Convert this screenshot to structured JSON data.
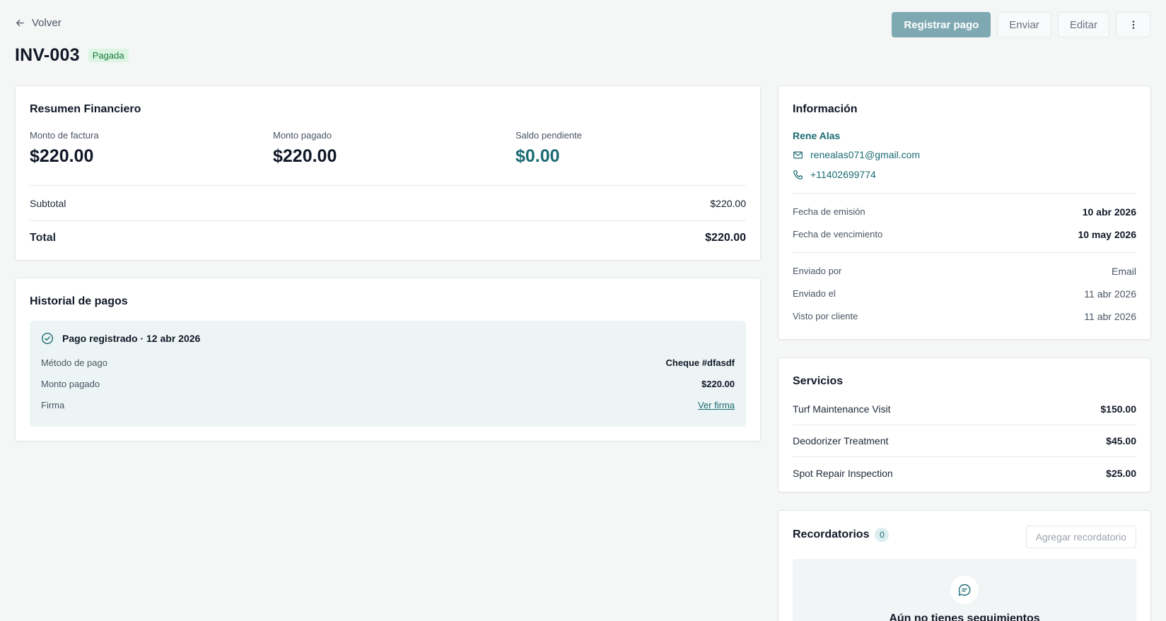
{
  "nav": {
    "back_label": "Volver"
  },
  "actions": {
    "register_payment": "Registrar pago",
    "send": "Enviar",
    "edit": "Editar",
    "more": "⋮"
  },
  "invoice": {
    "number": "INV-003",
    "status": "Pagada"
  },
  "summary": {
    "title": "Resumen Financiero",
    "invoice_amount_label": "Monto de factura",
    "invoice_amount": "$220.00",
    "paid_amount_label": "Monto pagado",
    "paid_amount": "$220.00",
    "balance_label": "Saldo pendiente",
    "balance": "$0.00",
    "subtotal_label": "Subtotal",
    "subtotal": "$220.00",
    "total_label": "Total",
    "total": "$220.00"
  },
  "history": {
    "title": "Historial de pagos",
    "entry": {
      "heading": "Pago registrado · 12 abr 2026",
      "method_label": "Método de pago",
      "method": "Cheque #dfasdf",
      "amount_label": "Monto pagado",
      "amount": "$220.00",
      "signature_label": "Firma",
      "signature_link": "Ver firma"
    }
  },
  "info": {
    "title": "Información",
    "client_name": "Rene Alas",
    "email": "renealas071@gmail.com",
    "phone": "+11402699774",
    "issue_date_label": "Fecha de emisión",
    "issue_date": "10 abr 2026",
    "due_date_label": "Fecha de vencimiento",
    "due_date": "10 may 2026",
    "sent_by_label": "Enviado por",
    "sent_by": "Email",
    "sent_on_label": "Enviado el",
    "sent_on": "11 abr 2026",
    "viewed_label": "Visto por cliente",
    "viewed_on": "11 abr 2026"
  },
  "services": {
    "title": "Servicios",
    "items": [
      {
        "name": "Turf Maintenance Visit",
        "price": "$150.00"
      },
      {
        "name": "Deodorizer Treatment",
        "price": "$45.00"
      },
      {
        "name": "Spot Repair Inspection",
        "price": "$25.00"
      }
    ]
  },
  "reminders": {
    "title": "Recordatorios",
    "count": "0",
    "add_label": "Agregar recordatorio",
    "empty_text": "Aún no tienes seguimientos"
  },
  "colors": {
    "accent": "#1b6b73",
    "primary_button": "#7ea9b2",
    "paid_badge_bg": "#dcf5e3",
    "paid_badge_text": "#177a3b",
    "background": "#f5f7f6"
  }
}
